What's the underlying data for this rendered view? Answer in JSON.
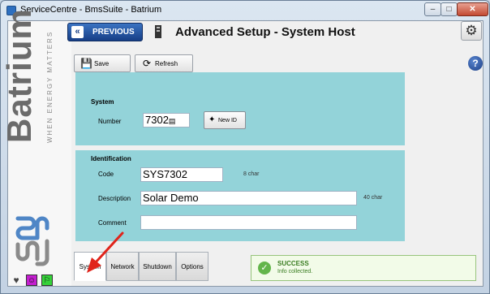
{
  "window": {
    "title": "ServiceCentre - BmsSuite - Batrium",
    "min_glyph": "–",
    "max_glyph": "□",
    "close_glyph": "✕"
  },
  "brand": {
    "name": "Batrium",
    "tagline": "WHEN ENERGY MATTERS"
  },
  "header": {
    "previous_label": "PREVIOUS",
    "title": "Advanced Setup - System Host"
  },
  "toolbar": {
    "save_label": "Save",
    "refresh_label": "Refresh"
  },
  "system": {
    "section_title": "System",
    "number_label": "Number",
    "number_value": "7302",
    "new_id_label": "New ID"
  },
  "identification": {
    "section_title": "Identification",
    "code_label": "Code",
    "code_value": "SYS7302",
    "code_hint": "8 char",
    "description_label": "Description",
    "description_value": "Solar Demo",
    "description_hint": "40 char",
    "comment_label": "Comment",
    "comment_value": ""
  },
  "tabs": [
    {
      "label": "System",
      "active": true
    },
    {
      "label": "Network",
      "active": false
    },
    {
      "label": "Shutdown",
      "active": false
    },
    {
      "label": "Options",
      "active": false
    }
  ],
  "status": {
    "title": "SUCCESS",
    "message": "Info collected."
  },
  "colors": {
    "panel": "#93d3d9",
    "accent": "#163e86",
    "success": "#63b54b",
    "arrow": "#e0241b"
  },
  "icons": {
    "heart": "heart-icon",
    "magenta": "person-icon",
    "green": "run-icon"
  }
}
